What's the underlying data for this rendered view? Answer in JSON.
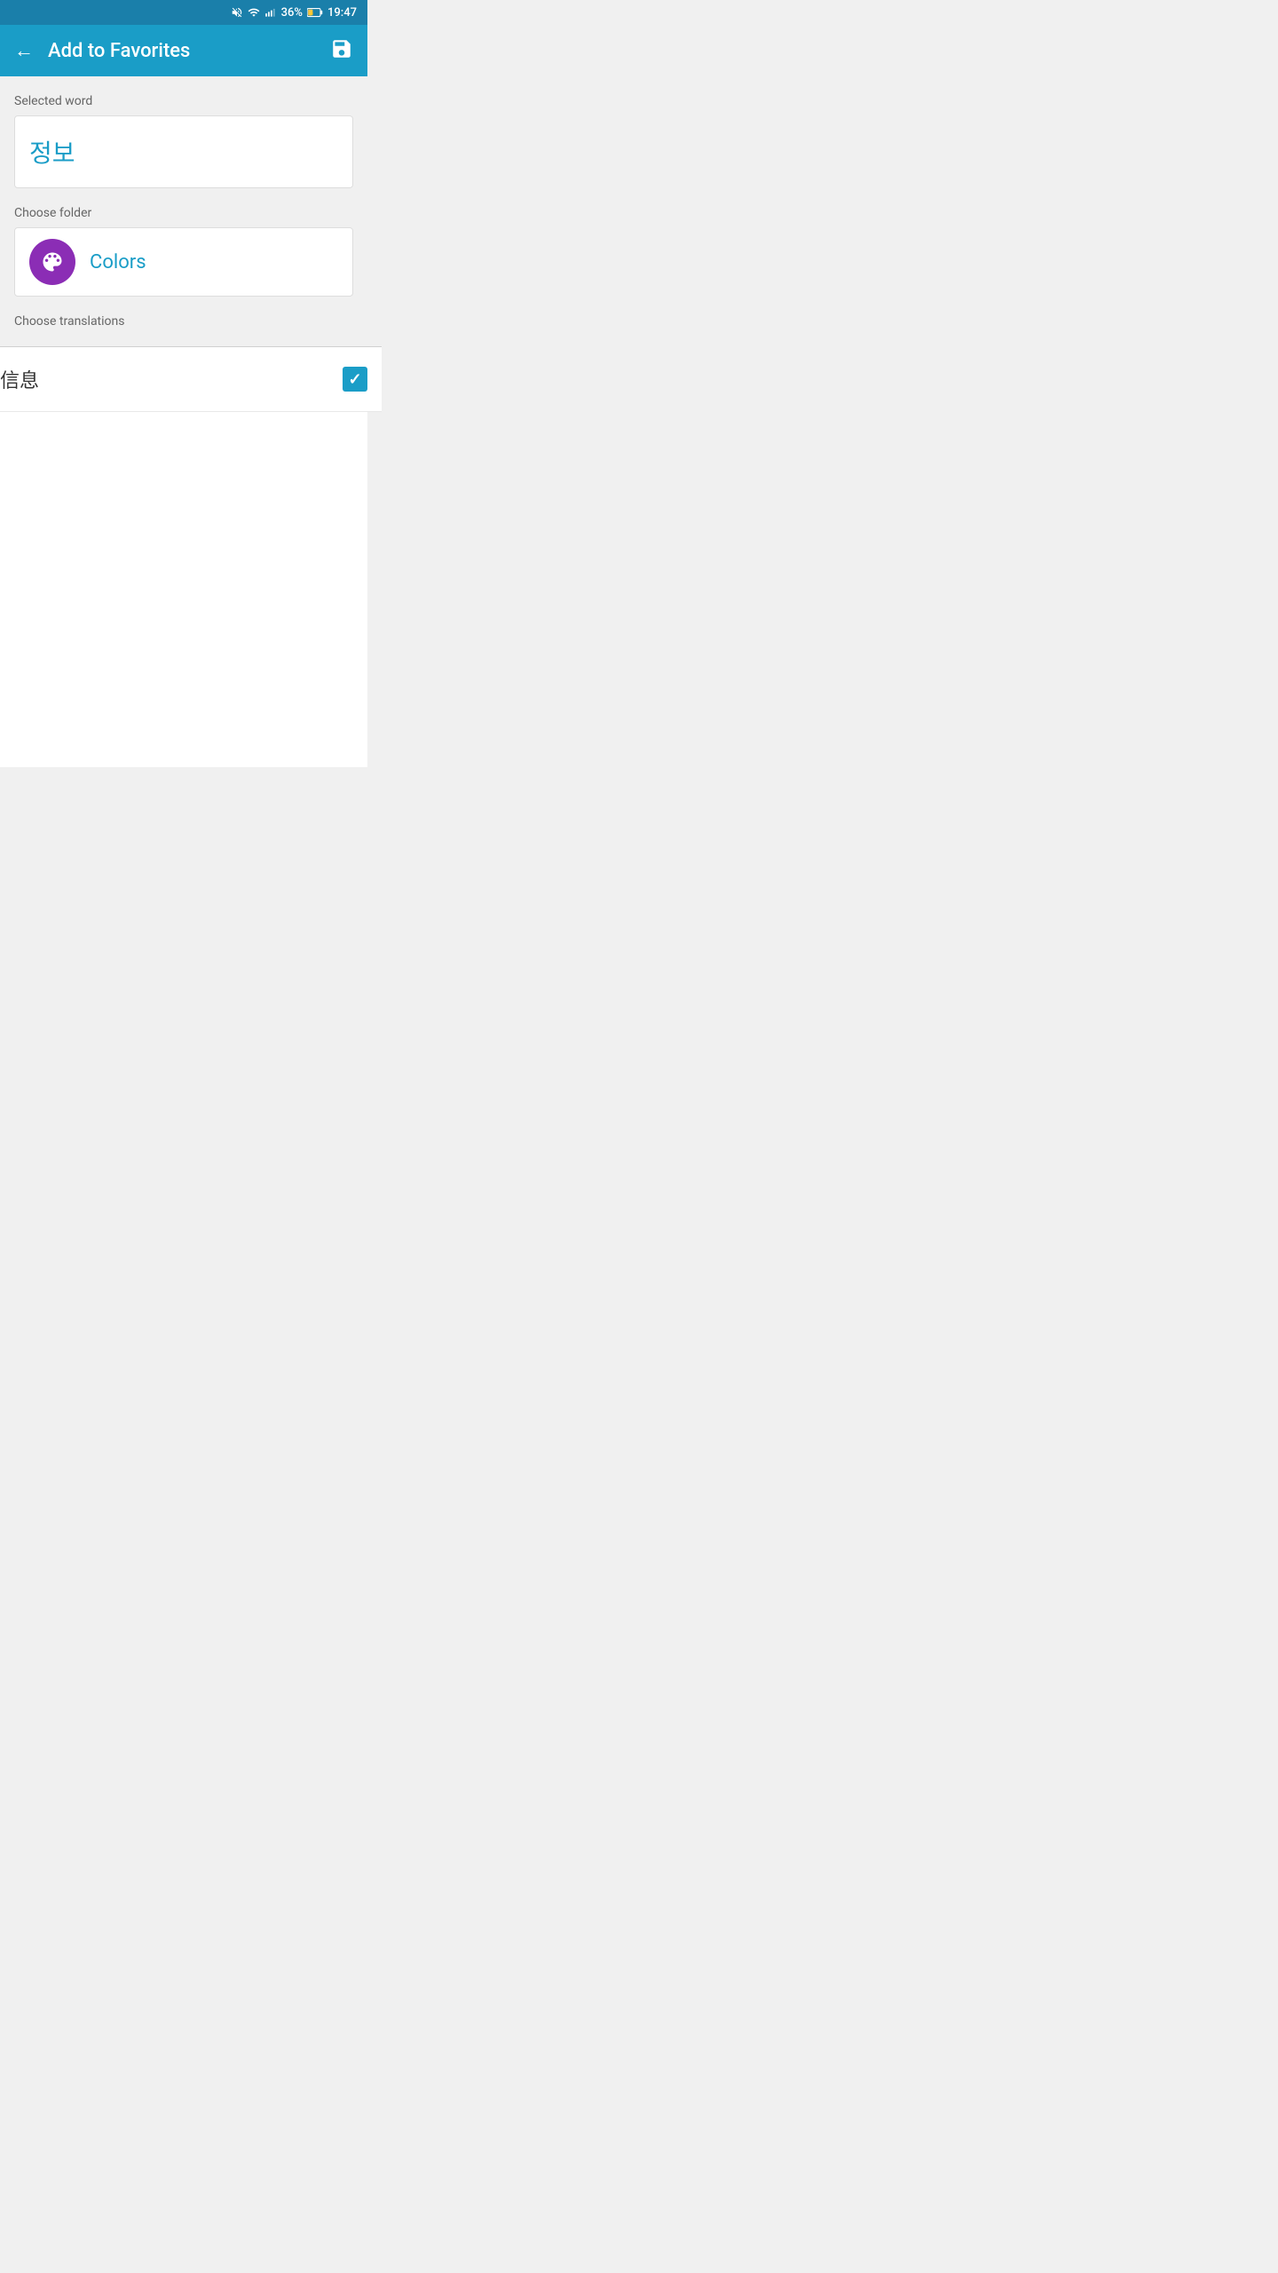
{
  "statusBar": {
    "battery": "36%",
    "time": "19:47"
  },
  "appBar": {
    "title": "Add to Favorites",
    "backLabel": "←",
    "saveLabel": "💾"
  },
  "selectedWord": {
    "label": "Selected word",
    "value": "정보"
  },
  "chooseFolder": {
    "label": "Choose folder",
    "folderName": "Colors"
  },
  "chooseTranslations": {
    "label": "Choose translations"
  },
  "translations": [
    {
      "text": "信息",
      "checked": true
    }
  ],
  "colors": {
    "appBarBg": "#1a9dc7",
    "statusBarBg": "#1a7faa",
    "folderIconBg": "#8b2db5",
    "checkboxBg": "#1a9dc7",
    "wordColor": "#1a9dc7",
    "folderNameColor": "#1a9dc7"
  }
}
